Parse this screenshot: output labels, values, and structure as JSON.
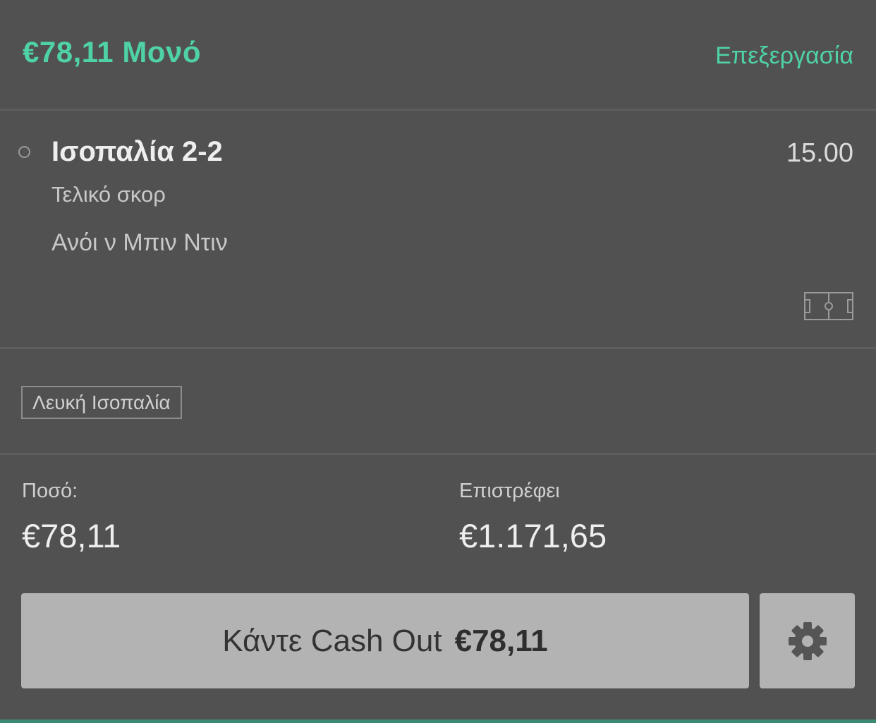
{
  "header": {
    "title": "€78,11 Μονό",
    "edit_label": "Επεξεργασία"
  },
  "selection": {
    "name": "Ισοπαλία 2-2",
    "odds": "15.00",
    "market": "Τελικό σκορ",
    "event": "Ανόι ν Μπιν Ντιν",
    "sport_icon": "football-pitch-icon"
  },
  "tag": {
    "label": "Λευκή Ισοπαλία"
  },
  "stake": {
    "label": "Ποσό:",
    "value": "€78,11"
  },
  "returns": {
    "label": "Επιστρέφει",
    "value": "€1.171,65"
  },
  "cashout": {
    "label": "Κάντε Cash Out",
    "amount": "€78,11"
  },
  "settings": {
    "icon": "gear-icon"
  },
  "colors": {
    "accent": "#4fd2a5",
    "background": "#515151",
    "button": "#b3b3b3",
    "bottom_bar": "#3c8a73"
  }
}
